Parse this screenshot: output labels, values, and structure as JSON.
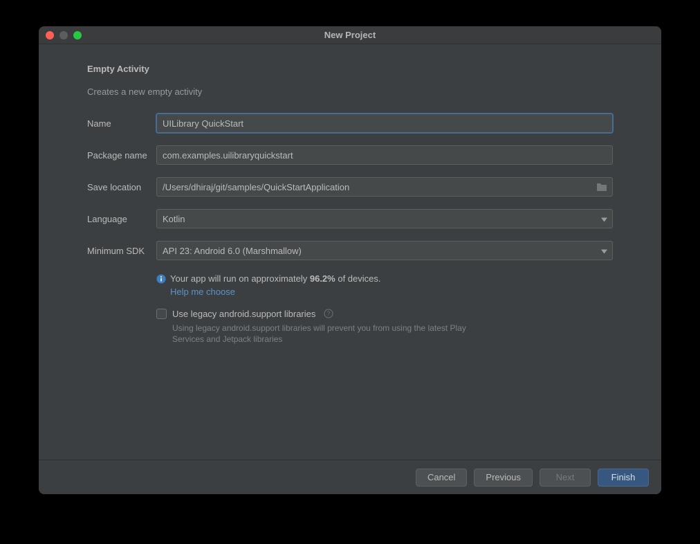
{
  "window": {
    "title": "New Project"
  },
  "header": {
    "heading": "Empty Activity",
    "subheading": "Creates a new empty activity"
  },
  "form": {
    "name_label": "Name",
    "name_value": "UILibrary QuickStart",
    "package_label": "Package name",
    "package_value": "com.examples.uilibraryquickstart",
    "location_label": "Save location",
    "location_value": "/Users/dhiraj/git/samples/QuickStartApplication",
    "language_label": "Language",
    "language_value": "Kotlin",
    "minsdk_label": "Minimum SDK",
    "minsdk_value": "API 23: Android 6.0 (Marshmallow)"
  },
  "info": {
    "prefix": "Your app will run on approximately ",
    "percent": "96.2%",
    "suffix": " of devices.",
    "help_link": "Help me choose"
  },
  "legacy": {
    "checkbox_label": "Use legacy android.support libraries",
    "hint": "Using legacy android.support libraries will prevent you from using the latest Play Services and Jetpack libraries"
  },
  "footer": {
    "cancel": "Cancel",
    "previous": "Previous",
    "next": "Next",
    "finish": "Finish"
  }
}
